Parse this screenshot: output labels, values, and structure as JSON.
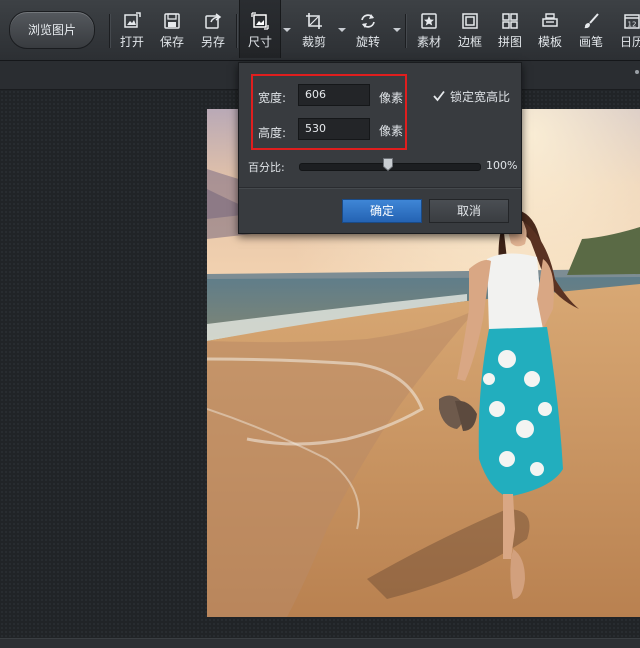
{
  "toolbar": {
    "browse_label": "浏览图片",
    "tools": [
      {
        "label": "打开",
        "icon": "open-image-icon"
      },
      {
        "label": "保存",
        "icon": "save-icon"
      },
      {
        "label": "另存",
        "icon": "save-as-icon"
      },
      {
        "label": "尺寸",
        "icon": "resize-icon",
        "active": true
      },
      {
        "label": "裁剪",
        "icon": "crop-icon"
      },
      {
        "label": "旋转",
        "icon": "rotate-icon"
      },
      {
        "label": "素材",
        "icon": "sticker-icon"
      },
      {
        "label": "边框",
        "icon": "frame-icon"
      },
      {
        "label": "拼图",
        "icon": "collage-icon"
      },
      {
        "label": "模板",
        "icon": "template-icon"
      },
      {
        "label": "画笔",
        "icon": "brush-icon"
      },
      {
        "label": "日历",
        "icon": "calendar-icon"
      }
    ]
  },
  "resize_dialog": {
    "width_label": "宽度:",
    "width_value": "606",
    "height_label": "高度:",
    "height_value": "530",
    "unit": "像素",
    "lock_ratio_label": "锁定宽高比",
    "lock_ratio_checked": true,
    "percent_label": "百分比:",
    "percent_value": "100%",
    "slider_level_percent": 100,
    "ok_label": "确定",
    "cancel_label": "取消"
  },
  "colors": {
    "highlight": "#e01e1e",
    "ok_button": "#2f74c6",
    "background": "#1e2124"
  },
  "calendar_icon_number": "12"
}
